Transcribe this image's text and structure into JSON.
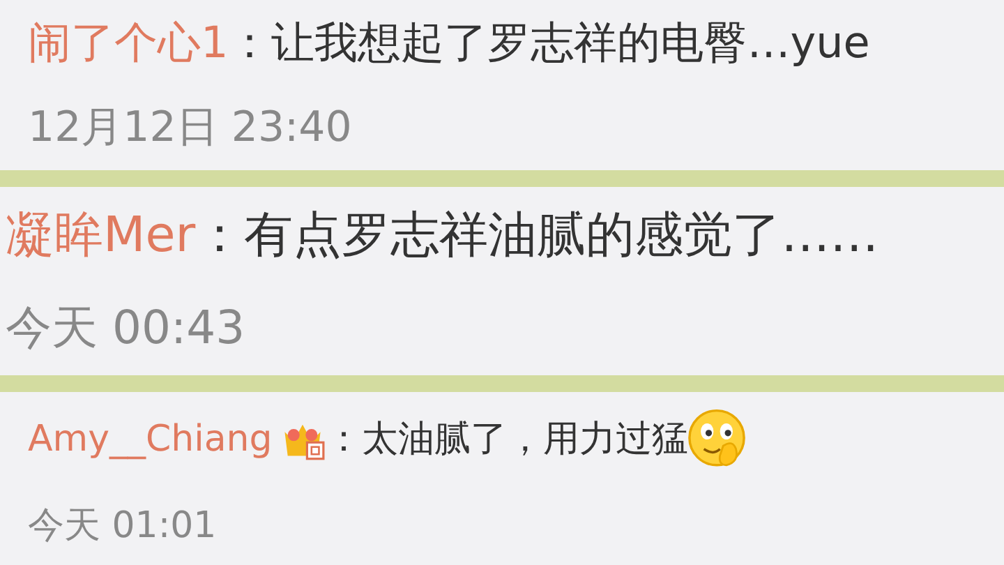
{
  "comments": [
    {
      "user": "闹了个心1",
      "text": "：让我想起了罗志祥的电臀…yue",
      "time": "12月12日 23:40"
    },
    {
      "user": "凝眸Mer",
      "text": "：有点罗志祥油腻的感觉了……",
      "time": "今天 00:43"
    },
    {
      "user": "Amy__Chiang",
      "badge": {
        "kind": "crown"
      },
      "text": "：太油腻了，用力过猛",
      "emoji": {
        "kind": "smiley"
      },
      "time": "今天 01:01"
    }
  ]
}
